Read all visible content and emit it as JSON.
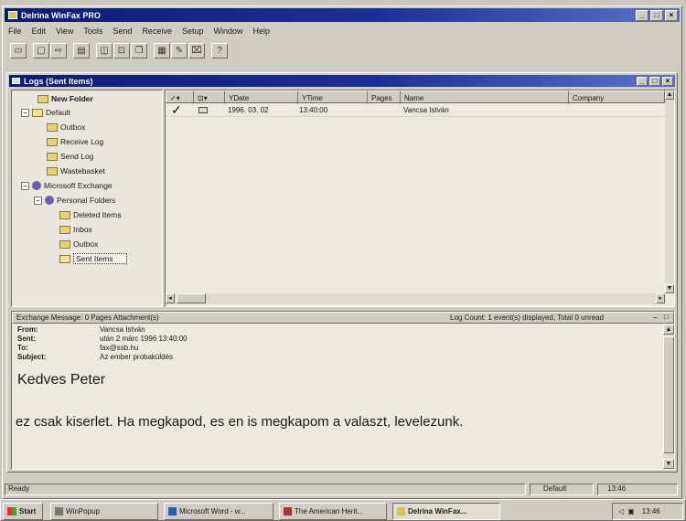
{
  "app": {
    "title": "Delrina WinFax PRO",
    "menu": [
      "File",
      "Edit",
      "View",
      "Tools",
      "Send",
      "Receive",
      "Setup",
      "Window",
      "Help"
    ]
  },
  "logs_window": {
    "title": "Logs (Sent Items)"
  },
  "tree": {
    "items": [
      {
        "label": "New Folder",
        "bold": true
      },
      {
        "label": "Default"
      },
      {
        "label": "Outbox"
      },
      {
        "label": "Receive Log"
      },
      {
        "label": "Send Log"
      },
      {
        "label": "Wastebasket"
      },
      {
        "label": "Microsoft Exchange"
      },
      {
        "label": "Personal Folders"
      },
      {
        "label": "Deleted Items"
      },
      {
        "label": "Inbox"
      },
      {
        "label": "Outbox"
      },
      {
        "label": "Sent Items",
        "selected": true
      }
    ]
  },
  "list": {
    "columns": [
      "YDate",
      "YTime",
      "Pages",
      "Name",
      "Company"
    ],
    "rows": [
      {
        "date": "1996. 03. 02",
        "time": "13:40:00",
        "pages": "",
        "name": "Vancsa István",
        "company": ""
      }
    ]
  },
  "preview": {
    "header_left": "Exchange Message: 0 Pages Attachment(s)",
    "header_right": "Log Count: 1 event(s) displayed, Total 0 unread",
    "fields": [
      {
        "label": "From:",
        "value": "Vancsa István"
      },
      {
        "label": "Sent:",
        "value": "után 2 márc 1996 13:40:00"
      },
      {
        "label": "To:",
        "value": "fax@ssb.hu"
      },
      {
        "label": "Subject:",
        "value": "Az ember probaküldés"
      }
    ],
    "greeting": "Kedves Peter",
    "body": "ez csak kiserlet. Ha megkapod, es en is megkapom a valaszt, levelezunk."
  },
  "statusbar": {
    "left": "Ready",
    "middle": "Default",
    "right": "13:46"
  },
  "taskbar": {
    "start": "Start",
    "items": [
      "WinPopup",
      "Microsoft Word - w...",
      "The American Herit...",
      "Delrina WinFax..."
    ],
    "clock": "13:46"
  }
}
